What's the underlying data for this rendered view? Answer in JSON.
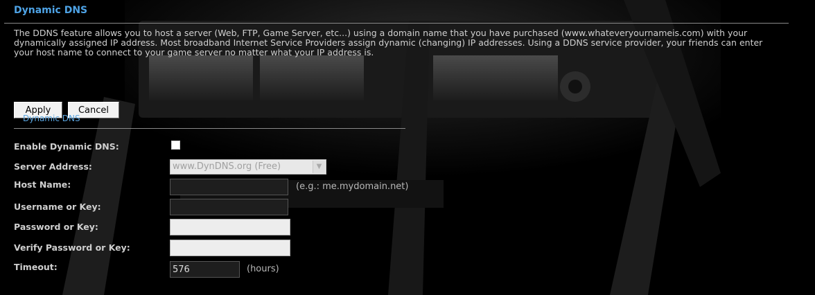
{
  "header": {
    "title": "Dynamic DNS"
  },
  "description": "The DDNS feature allows you to host a server (Web, FTP, Game Server, etc...) using a domain name that you have purchased (www.whateveryournameis.com) with your dynamically assigned IP address. Most broadband Internet Service Providers assign dynamic (changing) IP addresses. Using a DDNS service provider, your friends can enter your host name to connect to your game server no matter what your IP address is.",
  "toolbar": {
    "apply_label": "Apply",
    "cancel_label": "Cancel"
  },
  "section": {
    "title": "Dynamic DNS"
  },
  "form": {
    "enable_label": "Enable Dynamic DNS:",
    "enable_checked": false,
    "server_label": "Server Address:",
    "server_value": "www.DynDNS.org (Free)",
    "host_label": "Host Name:",
    "host_value": "",
    "host_hint": "(e.g.: me.mydomain.net)",
    "username_label": "Username or Key:",
    "username_value": "",
    "password_label": "Password or Key:",
    "password_value": "",
    "verify_label": "Verify Password or Key:",
    "verify_value": "",
    "timeout_label": "Timeout:",
    "timeout_value": "576",
    "timeout_unit": "(hours)"
  },
  "colors": {
    "background": "#000000",
    "title_blue": "#4ea3e6",
    "section_blue": "#5aa5e0",
    "label_gray": "#cfcfcf"
  },
  "icons": {
    "select_arrow": "chevron-down-icon"
  }
}
